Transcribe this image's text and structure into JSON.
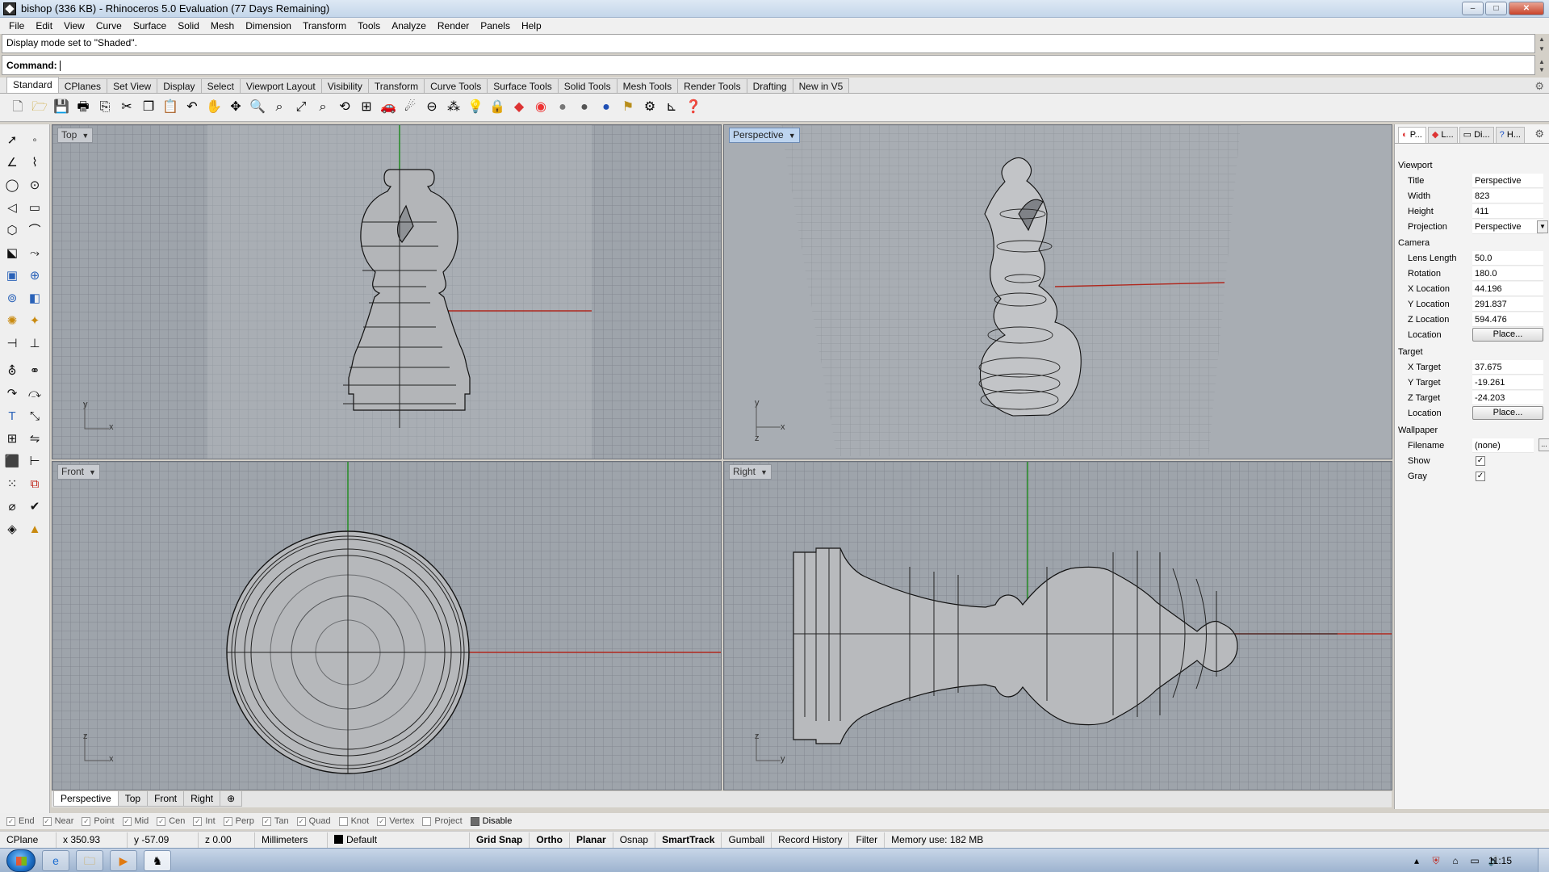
{
  "window": {
    "title": "bishop (336 KB) - Rhinoceros 5.0 Evaluation (77 Days Remaining)",
    "min": "–",
    "max": "□",
    "close": "✕"
  },
  "menu": [
    "File",
    "Edit",
    "View",
    "Curve",
    "Surface",
    "Solid",
    "Mesh",
    "Dimension",
    "Transform",
    "Tools",
    "Analyze",
    "Render",
    "Panels",
    "Help"
  ],
  "command": {
    "history": "Display mode set to \"Shaded\".",
    "prompt": "Command:"
  },
  "toolbar_tabs": [
    {
      "label": "Standard",
      "active": true
    },
    {
      "label": "CPlanes"
    },
    {
      "label": "Set View"
    },
    {
      "label": "Display"
    },
    {
      "label": "Select"
    },
    {
      "label": "Viewport Layout"
    },
    {
      "label": "Visibility"
    },
    {
      "label": "Transform"
    },
    {
      "label": "Curve Tools"
    },
    {
      "label": "Surface Tools"
    },
    {
      "label": "Solid Tools"
    },
    {
      "label": "Mesh Tools"
    },
    {
      "label": "Render Tools"
    },
    {
      "label": "Drafting"
    },
    {
      "label": "New in V5"
    }
  ],
  "toolbar_icons": [
    "new-icon",
    "open-icon",
    "save-icon",
    "print-icon",
    "import-icon",
    "cut-icon",
    "copy-icon",
    "paste-icon",
    "undo-icon",
    "pan-icon",
    "move-view-icon",
    "zoom-icon",
    "zoom-window-icon",
    "zoom-extents-icon",
    "zoom-selected-icon",
    "rotate-view-icon",
    "four-viewports-icon",
    "car-icon",
    "light-icon",
    "cplane-icon",
    "named-view-icon",
    "lightbulb-icon",
    "lock-icon",
    "layer-icon",
    "color-wheel-icon",
    "shaded-sphere-icon",
    "rendered-sphere-icon",
    "render-sphere-icon",
    "select-filter-icon",
    "options-icon",
    "dimension-icon",
    "help-icon"
  ],
  "viewports": {
    "top": {
      "label": "Top",
      "axis_y": "y",
      "axis_x": "x"
    },
    "perspective": {
      "label": "Perspective",
      "axis_y": "y",
      "axis_x": "x",
      "axis_z": "z"
    },
    "front": {
      "label": "Front",
      "axis_y": "z",
      "axis_x": "x"
    },
    "right": {
      "label": "Right",
      "axis_y": "z",
      "axis_x": "y"
    }
  },
  "viewport_tabs": [
    {
      "label": "Perspective",
      "active": true
    },
    {
      "label": "Top"
    },
    {
      "label": "Front"
    },
    {
      "label": "Right"
    },
    {
      "label": "⊕"
    }
  ],
  "panel_tabs": [
    {
      "label": "P...",
      "active": true
    },
    {
      "label": "L..."
    },
    {
      "label": "Di..."
    },
    {
      "label": "H..."
    }
  ],
  "properties": {
    "viewport_header": "Viewport",
    "title_label": "Title",
    "title": "Perspective",
    "width_label": "Width",
    "width": "823",
    "height_label": "Height",
    "height": "411",
    "projection_label": "Projection",
    "projection": "Perspective",
    "camera_header": "Camera",
    "lens_label": "Lens Length",
    "lens": "50.0",
    "rotation_label": "Rotation",
    "rotation": "180.0",
    "xloc_label": "X Location",
    "xloc": "44.196",
    "yloc_label": "Y Location",
    "yloc": "291.837",
    "zloc_label": "Z Location",
    "zloc": "594.476",
    "loc_label": "Location",
    "place": "Place...",
    "target_header": "Target",
    "xt_label": "X Target",
    "xt": "37.675",
    "yt_label": "Y Target",
    "yt": "-19.261",
    "zt_label": "Z Target",
    "zt": "-24.203",
    "tloc_label": "Location",
    "wallpaper_header": "Wallpaper",
    "filename_label": "Filename",
    "filename": "(none)",
    "dots": "...",
    "show_label": "Show",
    "show": true,
    "gray_label": "Gray",
    "gray": true
  },
  "osnaps": [
    {
      "label": "End",
      "checked": true
    },
    {
      "label": "Near",
      "checked": true
    },
    {
      "label": "Point",
      "checked": true
    },
    {
      "label": "Mid",
      "checked": true
    },
    {
      "label": "Cen",
      "checked": true
    },
    {
      "label": "Int",
      "checked": true
    },
    {
      "label": "Perp",
      "checked": true
    },
    {
      "label": "Tan",
      "checked": true
    },
    {
      "label": "Quad",
      "checked": true
    },
    {
      "label": "Knot",
      "checked": false
    },
    {
      "label": "Vertex",
      "checked": true
    },
    {
      "label": "Project",
      "checked": false
    },
    {
      "label": "Disable",
      "checked": true
    }
  ],
  "status": {
    "cplane": "CPlane",
    "x": "x 350.93",
    "y": "y -57.09",
    "z": "z 0.00",
    "units": "Millimeters",
    "layer": "Default",
    "grid_snap": "Grid Snap",
    "ortho": "Ortho",
    "planar": "Planar",
    "osnap": "Osnap",
    "smarttrack": "SmartTrack",
    "gumball": "Gumball",
    "record_history": "Record History",
    "filter": "Filter",
    "memory": "Memory use: 182 MB"
  },
  "taskbar": {
    "clock": "11:15",
    "apps": [
      "ie-icon",
      "explorer-icon",
      "media-player-icon",
      "rhino-icon"
    ]
  },
  "colors": {
    "viewport_bg": "#9ea4ab",
    "x_axis": "#b0281e",
    "y_axis": "#1c8a1c",
    "active_label": "#bdd4ef"
  }
}
